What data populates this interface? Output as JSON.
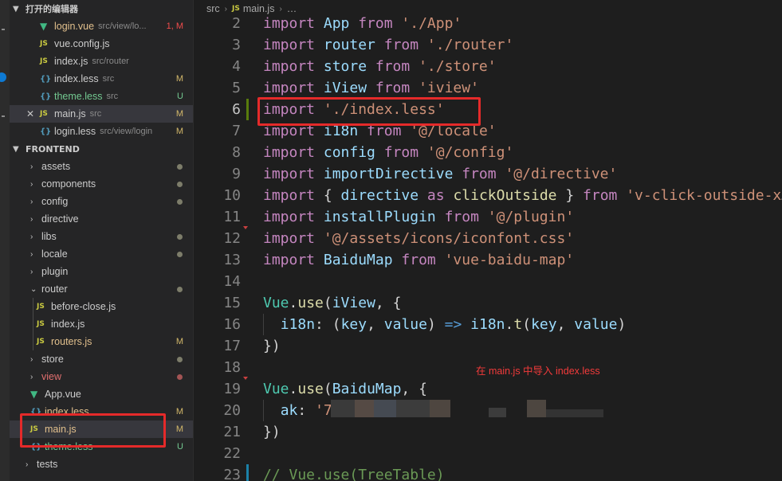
{
  "sidebar": {
    "open_editors_title": "打开的编辑器",
    "open_editors": [
      {
        "icon": "vue",
        "name": "login.vue",
        "desc": "src/view/lo...",
        "status": "1, M",
        "name_color": "yel",
        "status_color": "err"
      },
      {
        "icon": "js",
        "name": "vue.config.js",
        "desc": "",
        "status": "",
        "name_color": "",
        "status_color": ""
      },
      {
        "icon": "js",
        "name": "index.js",
        "desc": "src/router",
        "status": "",
        "name_color": "",
        "status_color": ""
      },
      {
        "icon": "less",
        "name": "index.less",
        "desc": "src",
        "status": "M",
        "name_color": "",
        "status_color": "mod"
      },
      {
        "icon": "less",
        "name": "theme.less",
        "desc": "src",
        "status": "U",
        "name_color": "grn",
        "status_color": "untr"
      },
      {
        "icon": "js",
        "name": "main.js",
        "desc": "src",
        "status": "M",
        "name_color": "",
        "status_color": "mod"
      },
      {
        "icon": "less",
        "name": "login.less",
        "desc": "src/view/login",
        "status": "M",
        "name_color": "",
        "status_color": "mod"
      }
    ],
    "project_title": "FRONTEND",
    "tree": [
      {
        "type": "folder",
        "name": "assets",
        "status": "dot"
      },
      {
        "type": "folder",
        "name": "components",
        "status": "dot"
      },
      {
        "type": "folder",
        "name": "config",
        "status": "dot"
      },
      {
        "type": "folder",
        "name": "directive",
        "status": ""
      },
      {
        "type": "folder",
        "name": "libs",
        "status": "dot"
      },
      {
        "type": "folder",
        "name": "locale",
        "status": "dot"
      },
      {
        "type": "folder",
        "name": "plugin",
        "status": ""
      },
      {
        "type": "folder-open",
        "name": "router",
        "status": "dot"
      },
      {
        "type": "js-child",
        "name": "before-close.js",
        "status": ""
      },
      {
        "type": "js-child",
        "name": "index.js",
        "status": ""
      },
      {
        "type": "js-child",
        "name": "routers.js",
        "status": "M"
      },
      {
        "type": "folder",
        "name": "store",
        "status": "dot"
      },
      {
        "type": "folder",
        "name": "view",
        "status": "dot-red"
      },
      {
        "type": "vue",
        "name": "App.vue",
        "status": ""
      },
      {
        "type": "less",
        "name": "index.less",
        "status": "M"
      },
      {
        "type": "js",
        "name": "main.js",
        "status": "M"
      },
      {
        "type": "less",
        "name": "theme.less",
        "status": "U"
      },
      {
        "type": "folder-root",
        "name": "tests",
        "status": ""
      }
    ]
  },
  "breadcrumb": {
    "folder": "src",
    "file": "main.js",
    "more": "…"
  },
  "code_lines": [
    {
      "n": "2",
      "tokens": [
        [
          "kw",
          "import "
        ],
        [
          "id",
          "App"
        ],
        [
          "kw",
          " from "
        ],
        [
          "str",
          "'./App'"
        ]
      ]
    },
    {
      "n": "3",
      "tokens": [
        [
          "kw",
          "import "
        ],
        [
          "id",
          "router"
        ],
        [
          "kw",
          " from "
        ],
        [
          "str",
          "'./router'"
        ]
      ]
    },
    {
      "n": "4",
      "tokens": [
        [
          "kw",
          "import "
        ],
        [
          "id",
          "store"
        ],
        [
          "kw",
          " from "
        ],
        [
          "str",
          "'./store'"
        ]
      ]
    },
    {
      "n": "5",
      "tokens": [
        [
          "kw",
          "import "
        ],
        [
          "id",
          "iView"
        ],
        [
          "kw",
          " from "
        ],
        [
          "str",
          "'iview'"
        ]
      ]
    },
    {
      "n": "6",
      "tokens": [
        [
          "kw",
          "import "
        ],
        [
          "str",
          "'./index.less'"
        ]
      ]
    },
    {
      "n": "7",
      "tokens": [
        [
          "kw",
          "import "
        ],
        [
          "id",
          "i18n"
        ],
        [
          "kw",
          " from "
        ],
        [
          "str",
          "'@/locale'"
        ]
      ]
    },
    {
      "n": "8",
      "tokens": [
        [
          "kw",
          "import "
        ],
        [
          "id",
          "config"
        ],
        [
          "kw",
          " from "
        ],
        [
          "str",
          "'@/config'"
        ]
      ]
    },
    {
      "n": "9",
      "tokens": [
        [
          "kw",
          "import "
        ],
        [
          "id",
          "importDirective"
        ],
        [
          "kw",
          " from "
        ],
        [
          "str",
          "'@/directive'"
        ]
      ]
    },
    {
      "n": "10",
      "tokens": [
        [
          "kw",
          "import "
        ],
        [
          "pl",
          "{ "
        ],
        [
          "id",
          "directive"
        ],
        [
          "kw",
          " as "
        ],
        [
          "fn",
          "clickOutside"
        ],
        [
          "pl",
          " } "
        ],
        [
          "kw",
          "from "
        ],
        [
          "str",
          "'v-click-outside-x"
        ]
      ]
    },
    {
      "n": "11",
      "tokens": [
        [
          "kw",
          "import "
        ],
        [
          "id",
          "installPlugin"
        ],
        [
          "kw",
          " from "
        ],
        [
          "str",
          "'@/plugin'"
        ]
      ]
    },
    {
      "n": "12",
      "tokens": [
        [
          "kw",
          "import "
        ],
        [
          "str",
          "'@/assets/icons/iconfont.css'"
        ]
      ]
    },
    {
      "n": "13",
      "tokens": [
        [
          "kw",
          "import "
        ],
        [
          "id",
          "BaiduMap"
        ],
        [
          "kw",
          " from "
        ],
        [
          "str",
          "'vue-baidu-map'"
        ]
      ]
    },
    {
      "n": "14",
      "tokens": []
    },
    {
      "n": "15",
      "tokens": [
        [
          "cls",
          "Vue"
        ],
        [
          "pl",
          "."
        ],
        [
          "fn",
          "use"
        ],
        [
          "pl",
          "("
        ],
        [
          "id",
          "iView"
        ],
        [
          "pl",
          ", {"
        ]
      ]
    },
    {
      "n": "16",
      "tokens": [
        [
          "pl",
          "  "
        ],
        [
          "id",
          "i18n"
        ],
        [
          "pl",
          ": ("
        ],
        [
          "id",
          "key"
        ],
        [
          "pl",
          ", "
        ],
        [
          "id",
          "value"
        ],
        [
          "pl",
          ") "
        ],
        [
          "op",
          "=>"
        ],
        [
          "pl",
          " "
        ],
        [
          "id",
          "i18n"
        ],
        [
          "pl",
          "."
        ],
        [
          "fn",
          "t"
        ],
        [
          "pl",
          "("
        ],
        [
          "id",
          "key"
        ],
        [
          "pl",
          ", "
        ],
        [
          "id",
          "value"
        ],
        [
          "pl",
          ")"
        ]
      ]
    },
    {
      "n": "17",
      "tokens": [
        [
          "pl",
          "})"
        ]
      ]
    },
    {
      "n": "18",
      "tokens": []
    },
    {
      "n": "19",
      "tokens": [
        [
          "cls",
          "Vue"
        ],
        [
          "pl",
          "."
        ],
        [
          "fn",
          "use"
        ],
        [
          "pl",
          "("
        ],
        [
          "id",
          "BaiduMap"
        ],
        [
          "pl",
          ", {"
        ]
      ]
    },
    {
      "n": "20",
      "tokens": [
        [
          "pl",
          "  "
        ],
        [
          "id",
          "ak"
        ],
        [
          "pl",
          ": "
        ],
        [
          "str",
          "'7"
        ]
      ]
    },
    {
      "n": "21",
      "tokens": [
        [
          "pl",
          "})"
        ]
      ]
    },
    {
      "n": "22",
      "tokens": []
    },
    {
      "n": "23",
      "tokens": [
        [
          "cm",
          "// Vue.use(TreeTable)"
        ]
      ]
    }
  ],
  "annotation_text": "在 main.js 中导入 index.less",
  "colors": {
    "highlight_box": "#e52a2a",
    "annotation": "#f33b3b"
  }
}
